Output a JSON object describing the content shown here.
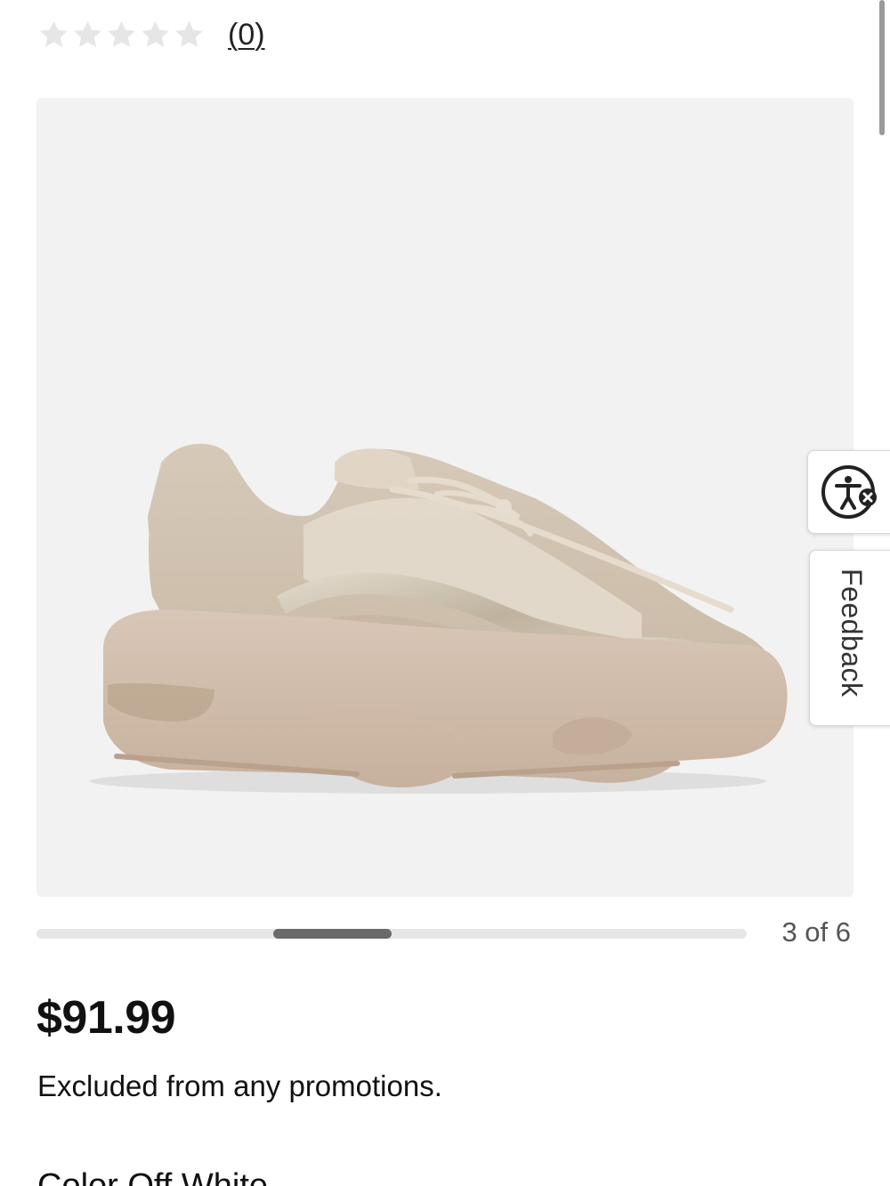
{
  "rating": {
    "stars_filled": 0,
    "stars_total": 5,
    "review_count_label": "(0)",
    "empty_star_color": "#e6e6e6"
  },
  "product_image": {
    "background_color": "#f2f2f2"
  },
  "side_widgets": {
    "accessibility_icon": "accessibility-person-icon",
    "feedback_label": "Feedback"
  },
  "carousel": {
    "current": 3,
    "total": 6,
    "counter_label": "3 of 6"
  },
  "price": {
    "amount": "$91.99",
    "note": "Excluded from any promotions."
  },
  "color": {
    "label": "Color Off White"
  }
}
